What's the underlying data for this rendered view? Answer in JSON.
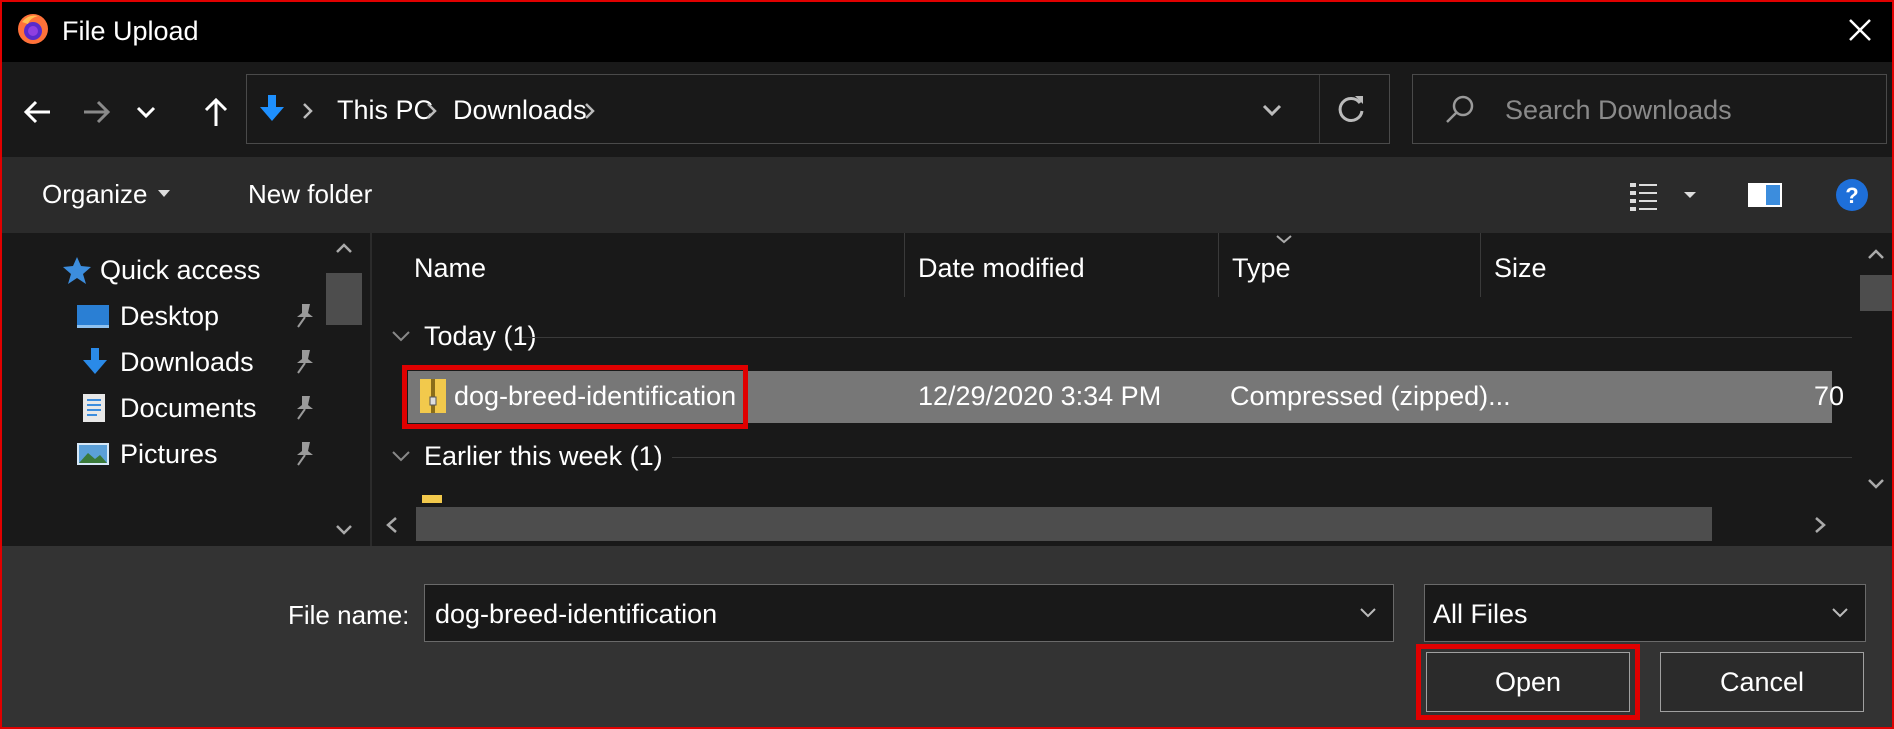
{
  "window": {
    "title": "File Upload",
    "app_icon": "firefox-icon",
    "close_icon": "close-icon",
    "frame_color": "#e00000"
  },
  "nav": {
    "back_icon": "arrow-left-icon",
    "forward_icon": "arrow-right-icon",
    "recent_icon": "chevron-down-icon",
    "up_icon": "arrow-up-icon"
  },
  "address": {
    "location_icon": "downloads-arrow-icon",
    "segments": [
      "This PC",
      "Downloads"
    ],
    "refresh_icon": "refresh-icon"
  },
  "search": {
    "placeholder": "Search Downloads"
  },
  "toolbar": {
    "organize_label": "Organize",
    "new_folder_label": "New folder",
    "help_label": "?"
  },
  "sidebar": {
    "items": [
      {
        "label": "Quick access",
        "icon": "star-icon",
        "pinned": false
      },
      {
        "label": "Desktop",
        "icon": "desktop-icon",
        "pinned": true
      },
      {
        "label": "Downloads",
        "icon": "download-icon",
        "pinned": true
      },
      {
        "label": "Documents",
        "icon": "document-icon",
        "pinned": true
      },
      {
        "label": "Pictures",
        "icon": "pictures-icon",
        "pinned": true
      }
    ]
  },
  "columns": [
    "Name",
    "Date modified",
    "Type",
    "Size"
  ],
  "groups": [
    {
      "label": "Today (1)"
    },
    {
      "label": "Earlier this week (1)"
    }
  ],
  "files": [
    {
      "name": "dog-breed-identification",
      "date_modified": "12/29/2020 3:34 PM",
      "type": "Compressed (zipped)...",
      "size": "70",
      "icon": "zip-folder-icon",
      "selected": true
    }
  ],
  "footer": {
    "file_name_label": "File name:",
    "file_name_value": "dog-breed-identification",
    "file_type_value": "All Files",
    "open_label": "Open",
    "cancel_label": "Cancel"
  }
}
